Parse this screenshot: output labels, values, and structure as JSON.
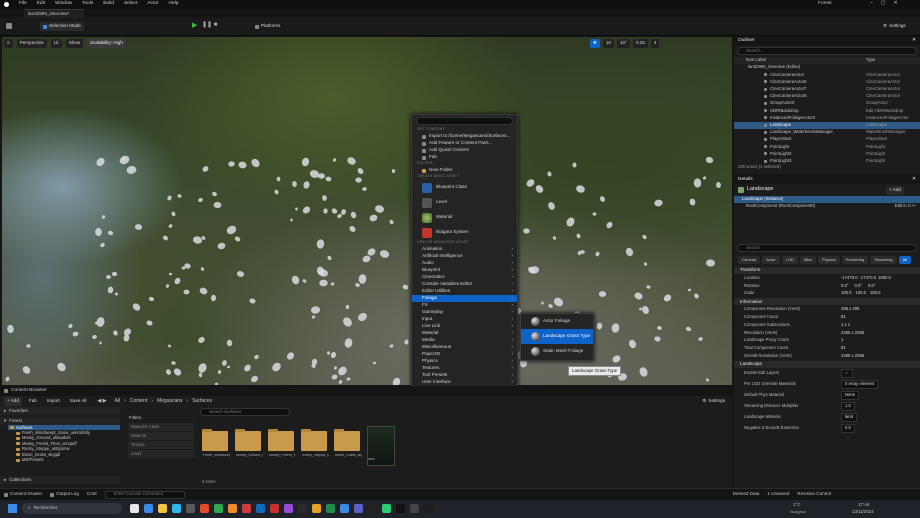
{
  "menubar": {
    "items": [
      "File",
      "Edit",
      "Window",
      "Tools",
      "Build",
      "Select",
      "Actor",
      "Help"
    ],
    "project_name": "Forest"
  },
  "project_tab": "land2999_interview*",
  "toolbar": {
    "mode": "Selection Mode",
    "platforms": "Platforms",
    "settings": "Settings"
  },
  "viewport": {
    "perspective": "Perspective",
    "lit": "Lit",
    "show": "Show",
    "scalability": "Scalability: High",
    "snap_grid": "10",
    "snap_angle": "10°",
    "scale": "0.25",
    "camera_speed": "4"
  },
  "context_menu": {
    "section_get": "GET CONTENT",
    "get_items": [
      "Import to /Game/Megascans/Surfaces...",
      "Add Feature or Content Pack...",
      "Add Quixel Content",
      "Fab"
    ],
    "section_folder": "FOLDER",
    "new_folder": "New Folder",
    "section_basic": "CREATE BASIC ASSET",
    "basic_assets": [
      "Blueprint Class",
      "Level",
      "Material",
      "Niagara System"
    ],
    "section_advanced": "CREATE ADVANCED ASSET",
    "advanced": [
      "Animation",
      "Artificial Intelligence",
      "Audio",
      "Blueprint",
      "Cinematics",
      "Console Variables Editor",
      "Editor Utilities",
      "Foliage",
      "FX",
      "Gameplay",
      "Input",
      "Live Link",
      "Material",
      "Media",
      "Miscellaneous",
      "Paper2D",
      "Physics",
      "Textures",
      "Tool Presets",
      "User Interface",
      "Water",
      "World"
    ],
    "selected": "Foliage"
  },
  "submenu": {
    "items": [
      "Actor Foliage",
      "Landscape Grass Type",
      "Static Mesh Foliage"
    ],
    "selected": "Landscape Grass Type"
  },
  "tooltip": "Landscape Grass Type",
  "outliner": {
    "title": "Outliner",
    "search_placeholder": "Search...",
    "col_label": "Item Label",
    "col_type": "Type",
    "root": "land2999_interview (Editor)",
    "rows": [
      {
        "label": "CineCameraActor",
        "type": "CineCameraActor"
      },
      {
        "label": "CineCameraActor6",
        "type": "CineCameraActor"
      },
      {
        "label": "CineCameraActor7",
        "type": "CineCameraActor"
      },
      {
        "label": "CineCameraActor8",
        "type": "CineCameraActor"
      },
      {
        "label": "GroupActor0",
        "type": "GroupActor"
      },
      {
        "label": "HDRIBackdrop",
        "type": "Edit HDRIBackdrop"
      },
      {
        "label": "InstancedFoliageActor0",
        "type": "InstancedFoliageActor"
      },
      {
        "label": "Landscape",
        "type": "Landscape"
      },
      {
        "label": "Landscape_WaterBrushManager",
        "type": "WaterBrushManager"
      },
      {
        "label": "PlayerStart",
        "type": "PlayerStart"
      },
      {
        "label": "PointLight",
        "type": "PointLight"
      },
      {
        "label": "PointLight2",
        "type": "PointLight"
      },
      {
        "label": "PointLight3",
        "type": "PointLight"
      }
    ],
    "selected": "Landscape",
    "footer": "230 actors (1 selected)"
  },
  "details": {
    "title": "Details",
    "actor": "Landscape",
    "add": "+ Add",
    "instance": "Landscape (Instance)",
    "root_component": "RootComponent (RootComponent0)",
    "edit_in": "Edit in C++",
    "search_placeholder": "Search",
    "tabs": [
      "General",
      "Actor",
      "LOD",
      "Misc",
      "Physics",
      "Rendering",
      "Streaming",
      "All"
    ],
    "active_tab": "All",
    "transform": {
      "header": "Transform",
      "location": "Location",
      "loc_vals": [
        "-17470.0",
        "-17470.0",
        "1000.0"
      ],
      "rotation": "Rotation",
      "rot_vals": [
        "0.0°",
        "0.0°",
        "0.0°"
      ],
      "scale": "Scale",
      "scale_vals": [
        "100.0",
        "100.0",
        "100.0"
      ]
    },
    "information_header": "Information",
    "info_rows": [
      {
        "label": "Component Resolution (Verts)",
        "value": "288 x 288"
      },
      {
        "label": "Component Count",
        "value": "81"
      },
      {
        "label": "Component Subsections",
        "value": "1 x 1"
      },
      {
        "label": "Resolution (Verts)",
        "value": "2296 x 2296"
      },
      {
        "label": "Landscape Proxy Count",
        "value": "1"
      },
      {
        "label": "Total Component Count",
        "value": "81"
      },
      {
        "label": "Overall Resolution (Verts)",
        "value": "2296 x 2296"
      }
    ],
    "landscape_header": "Landscape",
    "land_rows": [
      {
        "label": "Enable Edit Layers",
        "value": "✓"
      },
      {
        "label": "Per LOD Override Materials",
        "value": "0 Array element"
      },
      {
        "label": "Default Phys Material",
        "value": "None"
      },
      {
        "label": "Streaming Distance Multiplier",
        "value": "1.0"
      },
      {
        "label": "Landscape Material",
        "value": "land"
      },
      {
        "label": "Negative Z Bounds Extension",
        "value": "0.0"
      }
    ]
  },
  "content_browser": {
    "tab": "Content Browser",
    "add": "+ Add",
    "fab": "Fab",
    "import": "Import",
    "save_all": "Save All",
    "path": [
      "All",
      "Content",
      "Megascans",
      "Surfaces"
    ],
    "settings": "Settings",
    "search_placeholder": "Search Surfaces",
    "favorites": "Favorites",
    "root": "Forest",
    "tree": [
      "Surfaces",
      "Fresh_Windswept_Snow_uekmb0dy",
      "Mossy_Ground_ukkaab2e",
      "Mossy_Forest_Floor_wczpaff",
      "Rocky_Steppe_ukrlgomw",
      "Bison_Grass_skygdl",
      "MS/Presets"
    ],
    "filters": "Filters",
    "filter_items": [
      "Blueprint Class",
      "Material",
      "Texture",
      "Level"
    ],
    "assets": [
      "Fresh_Windswept_Snow_",
      "Mossy_Ground_ukkaab2e",
      "Mossy_Forest_Floor_wczpaff",
      "Rocky_Steppe_ukrlgomw",
      "Bison_Grass_skygdl",
      "land"
    ],
    "item_count": "6 items",
    "collections": "Collections"
  },
  "statusbar": {
    "content_drawer": "Content Drawer",
    "output_log": "Output Log",
    "cmd": "Cmd",
    "console_placeholder": "Enter Console Command",
    "derived_data": "Derived Data",
    "unsaved": "1 Unsaved",
    "revision": "Revision Control"
  },
  "taskbar": {
    "search": "Rechercher",
    "temp": "1°C",
    "weather": "Nuageux",
    "time": "17:44",
    "date": "13/11/2024"
  }
}
